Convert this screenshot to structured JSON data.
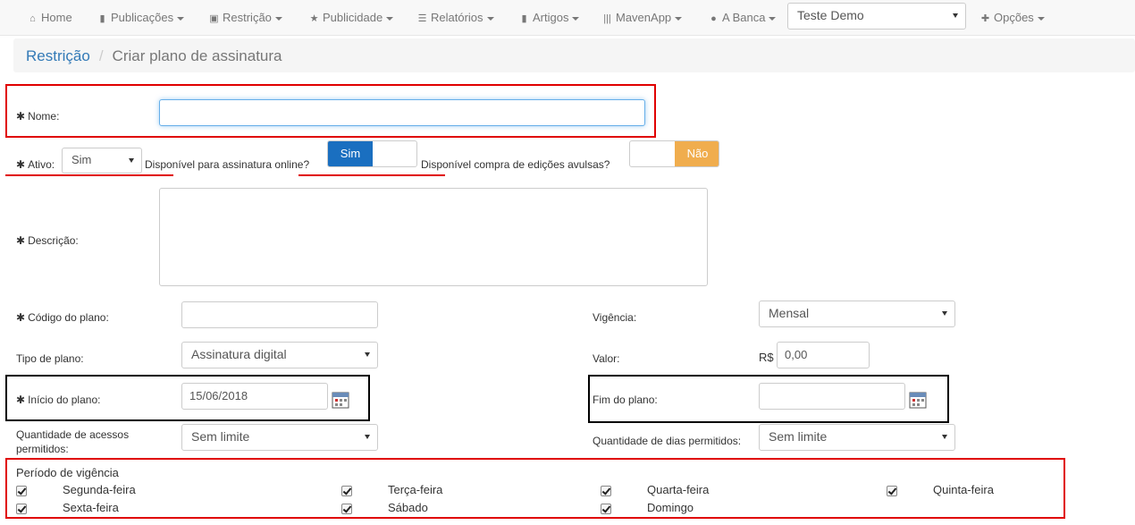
{
  "nav": {
    "home": "Home",
    "publicacoes": "Publicações",
    "restricao": "Restrição",
    "publicidade": "Publicidade",
    "relatorios": "Relatórios",
    "artigos": "Artigos",
    "mavenapp": "MavenApp",
    "abanca": "A Banca",
    "account_select": "Teste Demo",
    "opcoes": "Opções"
  },
  "breadcrumb": {
    "parent": "Restrição",
    "current": "Criar plano de assinatura"
  },
  "form": {
    "nome_label": "Nome:",
    "nome_value": "",
    "ativo_label": "Ativo:",
    "ativo_value": "Sim",
    "online_label": "Disponível para assinatura online?",
    "online_toggle_on": "Sim",
    "avulsas_label": "Disponível compra de edições avulsas?",
    "avulsas_toggle_off": "Não",
    "descricao_label": "Descrição:",
    "codigo_label": "Código do plano:",
    "vigencia_label": "Vigência:",
    "vigencia_value": "Mensal",
    "tipo_label": "Tipo de plano:",
    "tipo_value": "Assinatura digital",
    "valor_label": "Valor:",
    "valor_prefix": "R$",
    "valor_value": "0,00",
    "inicio_label": "Início do plano:",
    "inicio_value": "15/06/2018",
    "fim_label": "Fim do plano:",
    "fim_value": "",
    "qtd_acessos_label_1": "Quantidade de acessos",
    "qtd_acessos_label_2": "permitidos:",
    "qtd_acessos_value": "Sem limite",
    "qtd_dias_label": "Quantidade de dias permitidos:",
    "qtd_dias_value": "Sem limite",
    "periodo_label": "Período de vigência",
    "days": [
      "Segunda-feira",
      "Terça-feira",
      "Quarta-feira",
      "Quinta-feira",
      "Sexta-feira",
      "Sábado",
      "Domingo"
    ]
  },
  "colors": {
    "link": "#337ab7",
    "toggle_on": "#1a6fc0",
    "toggle_off": "#f0ad4e",
    "annotation_red": "#e00000"
  }
}
